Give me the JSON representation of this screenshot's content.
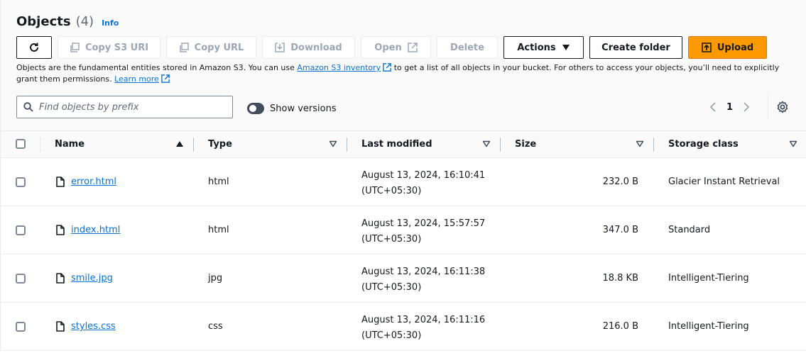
{
  "header": {
    "title": "Objects",
    "count": "(4)",
    "info": "Info"
  },
  "toolbar": {
    "refresh_icon": "refresh-icon",
    "copy_s3_uri": "Copy S3 URI",
    "copy_url": "Copy URL",
    "download": "Download",
    "open": "Open",
    "delete": "Delete",
    "actions": "Actions",
    "create_folder": "Create folder",
    "upload": "Upload"
  },
  "description": {
    "text1": "Objects are the fundamental entities stored in Amazon S3. You can use ",
    "link1": "Amazon S3 inventory",
    "text2": " to get a list of all objects in your bucket. For others to access your objects, you’ll need to explicitly grant them permissions. ",
    "link2": "Learn more"
  },
  "search": {
    "placeholder": "Find objects by prefix"
  },
  "show_versions": {
    "label": "Show versions",
    "enabled": false
  },
  "pagination": {
    "current_page": "1"
  },
  "table": {
    "columns": {
      "name": "Name",
      "type": "Type",
      "last_modified": "Last modified",
      "size": "Size",
      "storage_class": "Storage class"
    },
    "rows": [
      {
        "name": "error.html",
        "type": "html",
        "modified_line1": "August 13, 2024, 16:10:41",
        "modified_line2": "(UTC+05:30)",
        "size": "232.0 B",
        "storage_class": "Glacier Instant Retrieval"
      },
      {
        "name": "index.html",
        "type": "html",
        "modified_line1": "August 13, 2024, 15:57:57",
        "modified_line2": "(UTC+05:30)",
        "size": "347.0 B",
        "storage_class": "Standard"
      },
      {
        "name": "smile.jpg",
        "type": "jpg",
        "modified_line1": "August 13, 2024, 16:11:38",
        "modified_line2": "(UTC+05:30)",
        "size": "18.8 KB",
        "storage_class": "Intelligent-Tiering"
      },
      {
        "name": "styles.css",
        "type": "css",
        "modified_line1": "August 13, 2024, 16:11:16",
        "modified_line2": "(UTC+05:30)",
        "size": "216.0 B",
        "storage_class": "Intelligent-Tiering"
      }
    ]
  },
  "colors": {
    "link": "#0972d3",
    "primary": "#ff9900",
    "text": "#16191f",
    "disabled": "#9ba7b6"
  }
}
